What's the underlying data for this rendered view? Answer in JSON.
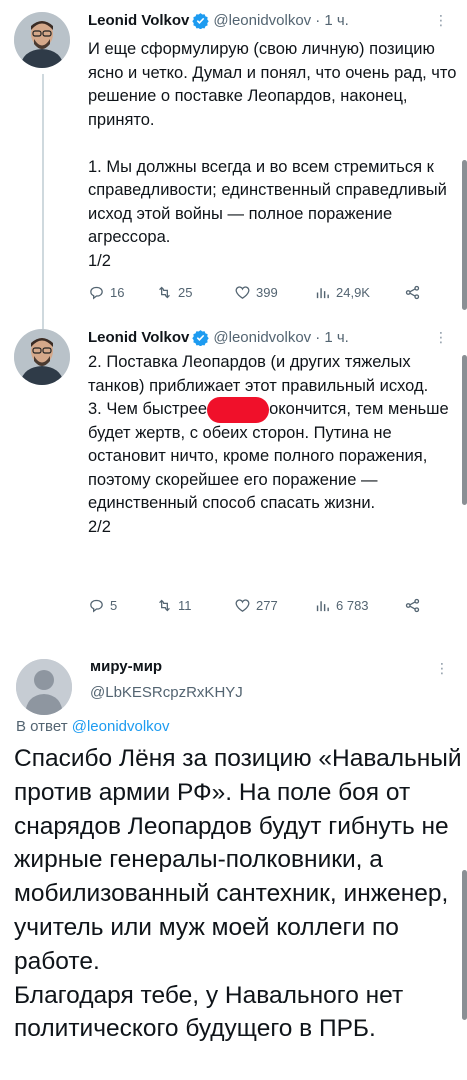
{
  "tweet1": {
    "author_name": "Leonid Volkov",
    "author_handle": "@leonidvolkov",
    "time": "· 1 ч.",
    "more": "⋮",
    "text": "И еще сформулирую (свою личную) позицию ясно и четко. Думал и понял, что очень рад, что решение о поставке Леопардов, наконец, принято.\n\n1. Мы должны всегда и во всем стремиться к справедливости; единственный справедливый исход этой войны — полное поражение агрессора.\n1/2",
    "replies": "16",
    "retweets": "25",
    "likes": "399",
    "views": "24,9K"
  },
  "tweet2": {
    "author_name": "Leonid Volkov",
    "author_handle": "@leonidvolkov",
    "time": "· 1 ч.",
    "more": "⋮",
    "text_a": "2. Поставка Леопардов (и других тяжелых танков) приближает этот правильный исход.\n3. Чем быстрее",
    "text_b": "окончится, тем меньше будет жертв, с обеих сторон. Путина не остановит ничто, кроме полного поражения, поэтому скорейшее его поражение — единственный способ спасать жизни.\n2/2",
    "replies": "5",
    "retweets": "11",
    "likes": "277",
    "views": "6 783"
  },
  "reply": {
    "author_name": "миру-мир",
    "author_handle": "@LbKESRcpzRxKHYJ",
    "more": "⋮",
    "replying_prefix": "В ответ",
    "replying_to": "@leonidvolkov",
    "text": "Спасибо Лёня за позицию «Навальный против армии РФ». На поле боя от снарядов Леопардов будут гибнуть не жирные генералы-полковники, а мобилизованный сантехник, инженер, учитель или муж моей коллеги по работе.\nБлагодаря тебе, у Навального нет политического будущего в ПРБ."
  },
  "colors": {
    "verified": "#1d9bf0",
    "link": "#1d9bf0",
    "muted": "#536471",
    "redaction": "#f0102a"
  },
  "icons": [
    "verified-badge-icon",
    "reply-icon",
    "retweet-icon",
    "like-icon",
    "views-icon",
    "share-icon",
    "more-icon"
  ]
}
